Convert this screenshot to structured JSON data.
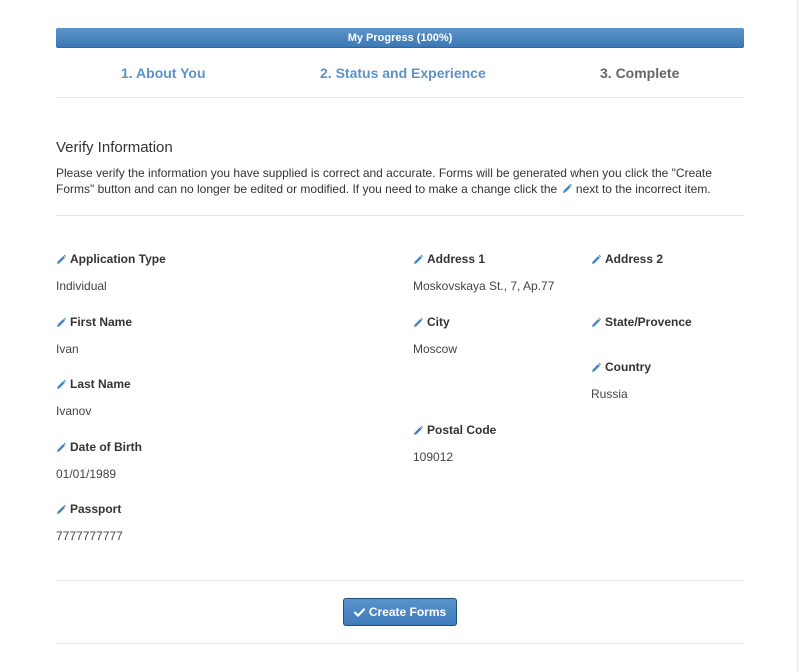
{
  "progress": {
    "label": "My Progress (100%)",
    "percent": 100,
    "bar_color": "#4a86c1"
  },
  "steps": [
    {
      "label": "1. About You"
    },
    {
      "label": "2. Status and Experience"
    },
    {
      "label": "3. Complete"
    }
  ],
  "section": {
    "title": "Verify Information",
    "intro_part1": "Please verify the information you have supplied is correct and accurate. Forms will be generated when you click the \"Create Forms\" button and can no longer be edited or modified. If you need to make a change click the",
    "intro_part2": "next to the incorrect item."
  },
  "fields": {
    "application_type": {
      "label": "Application Type",
      "value": "Individual"
    },
    "first_name": {
      "label": "First Name",
      "value": "Ivan"
    },
    "last_name": {
      "label": "Last Name",
      "value": "Ivanov"
    },
    "date_of_birth": {
      "label": "Date of Birth",
      "value": "01/01/1989"
    },
    "passport": {
      "label": "Passport",
      "value": "7777777777"
    },
    "address_1": {
      "label": "Address 1",
      "value": "Moskovskaya St., 7, Ap.77"
    },
    "city": {
      "label": "City",
      "value": "Moscow"
    },
    "postal_code": {
      "label": "Postal Code",
      "value": "109012"
    },
    "address_2": {
      "label": "Address 2",
      "value": ""
    },
    "state_provence": {
      "label": "State/Provence",
      "value": ""
    },
    "country": {
      "label": "Country",
      "value": "Russia"
    }
  },
  "actions": {
    "create_forms_label": "Create Forms"
  },
  "icons": {
    "edit": "pencil-icon",
    "confirm": "check-icon"
  },
  "colors": {
    "accent": "#4a86c1",
    "step_active": "#5b92c8",
    "step_inactive": "#666666",
    "pencil": "#4a86c1"
  }
}
